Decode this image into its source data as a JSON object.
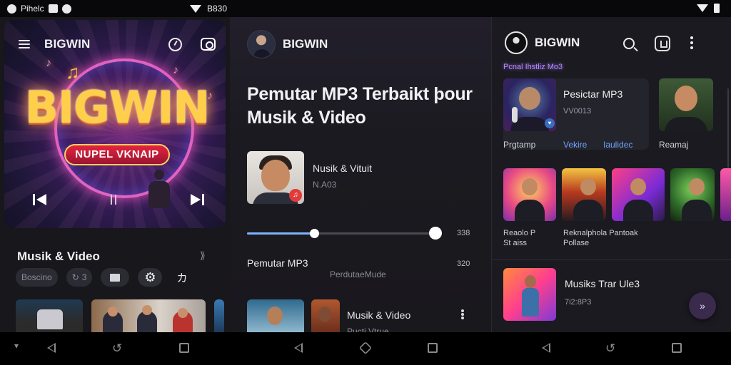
{
  "status_bar": {
    "app_text": "Pihelc",
    "center_text": "B830"
  },
  "left_panel": {
    "header_brand": "BIGWIN",
    "logo_text": "BIGWIN",
    "badge_text": "NUPEL VKNAIP",
    "section_title": "Musik & Video",
    "chip_filter": "Boscino",
    "chip_count": "3",
    "chip_extra": "カ"
  },
  "middle_panel": {
    "brand": "BIGWIN",
    "title": "Pemutar MP3 Terbaikt þour Musik & Video",
    "track_name": "Nusik & Vituit",
    "track_sub": "N.A03",
    "seek_time": "338",
    "now_label": "Pemutar MP3",
    "now_time": "320",
    "now_sub": "PerdutaeMude",
    "row_title": "Musik & Video",
    "row_sub": "Pucti Vtrue",
    "progress_fraction": 0.35
  },
  "right_panel": {
    "brand": "BIGWIN",
    "tag": "Pcnal Ihstliz Mo3",
    "featured_title": "Pesictar MP3",
    "featured_sub": "VV0013",
    "featured_caption": "Prgtamp",
    "featured_link1": "Vekire",
    "featured_link2": "Iaulidec",
    "side_caption": "Reamaj",
    "poster_caption1_line1": "Reaolo P",
    "poster_caption1_line2": "St aiss",
    "poster_caption2_line1": "Reknalphola Pantoak",
    "poster_caption2_line2": "Pollase",
    "item_title": "Musiks Trar Ule3",
    "item_sub": "7i2:8P3",
    "fab_symbol": "»"
  }
}
